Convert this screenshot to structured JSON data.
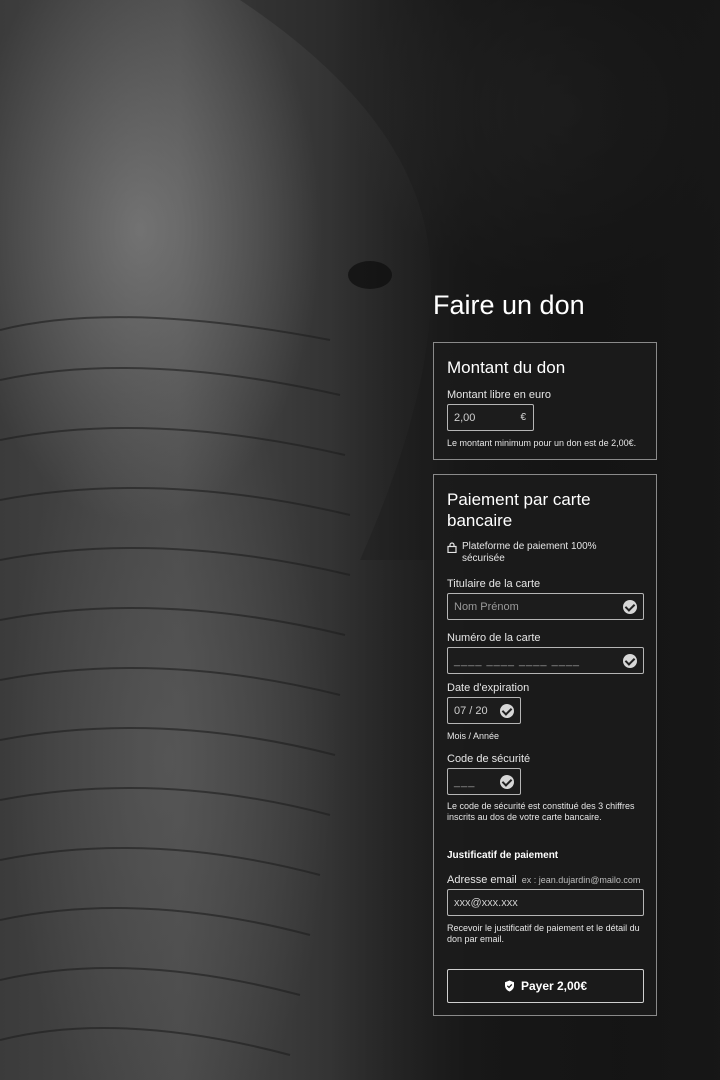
{
  "page": {
    "title": "Faire un don"
  },
  "amount_section": {
    "heading": "Montant du don",
    "label": "Montant libre en euro",
    "value": "2,00",
    "currency": "€",
    "hint": "Le montant minimum pour un don est de 2,00€."
  },
  "payment_section": {
    "heading": "Paiement par carte bancaire",
    "secure_note": "Plateforme de paiement 100% sécurisée",
    "cardholder": {
      "label": "Titulaire de la carte",
      "placeholder": "Nom Prénom"
    },
    "card_number": {
      "label": "Numéro de la carte",
      "placeholder": "____ ____ ____ ____"
    },
    "expiry": {
      "label": "Date d'expiration",
      "value": "07 / 20",
      "hint": "Mois / Année"
    },
    "cvc": {
      "label": "Code de sécurité",
      "placeholder": "___",
      "hint": "Le code de sécurité est constitué des 3 chiffres inscrits au dos de votre carte bancaire."
    },
    "receipt": {
      "heading": "Justificatif de paiement",
      "email_label": "Adresse email",
      "email_example": "ex : jean.dujardin@mailo.com",
      "email_placeholder": "xxx@xxx.xxx",
      "hint": "Recevoir le justificatif de paiement et le détail du don par email."
    },
    "pay_button": "Payer 2,00€"
  },
  "icons": [
    "lock-icon",
    "check-circle-icon",
    "shield-icon"
  ]
}
